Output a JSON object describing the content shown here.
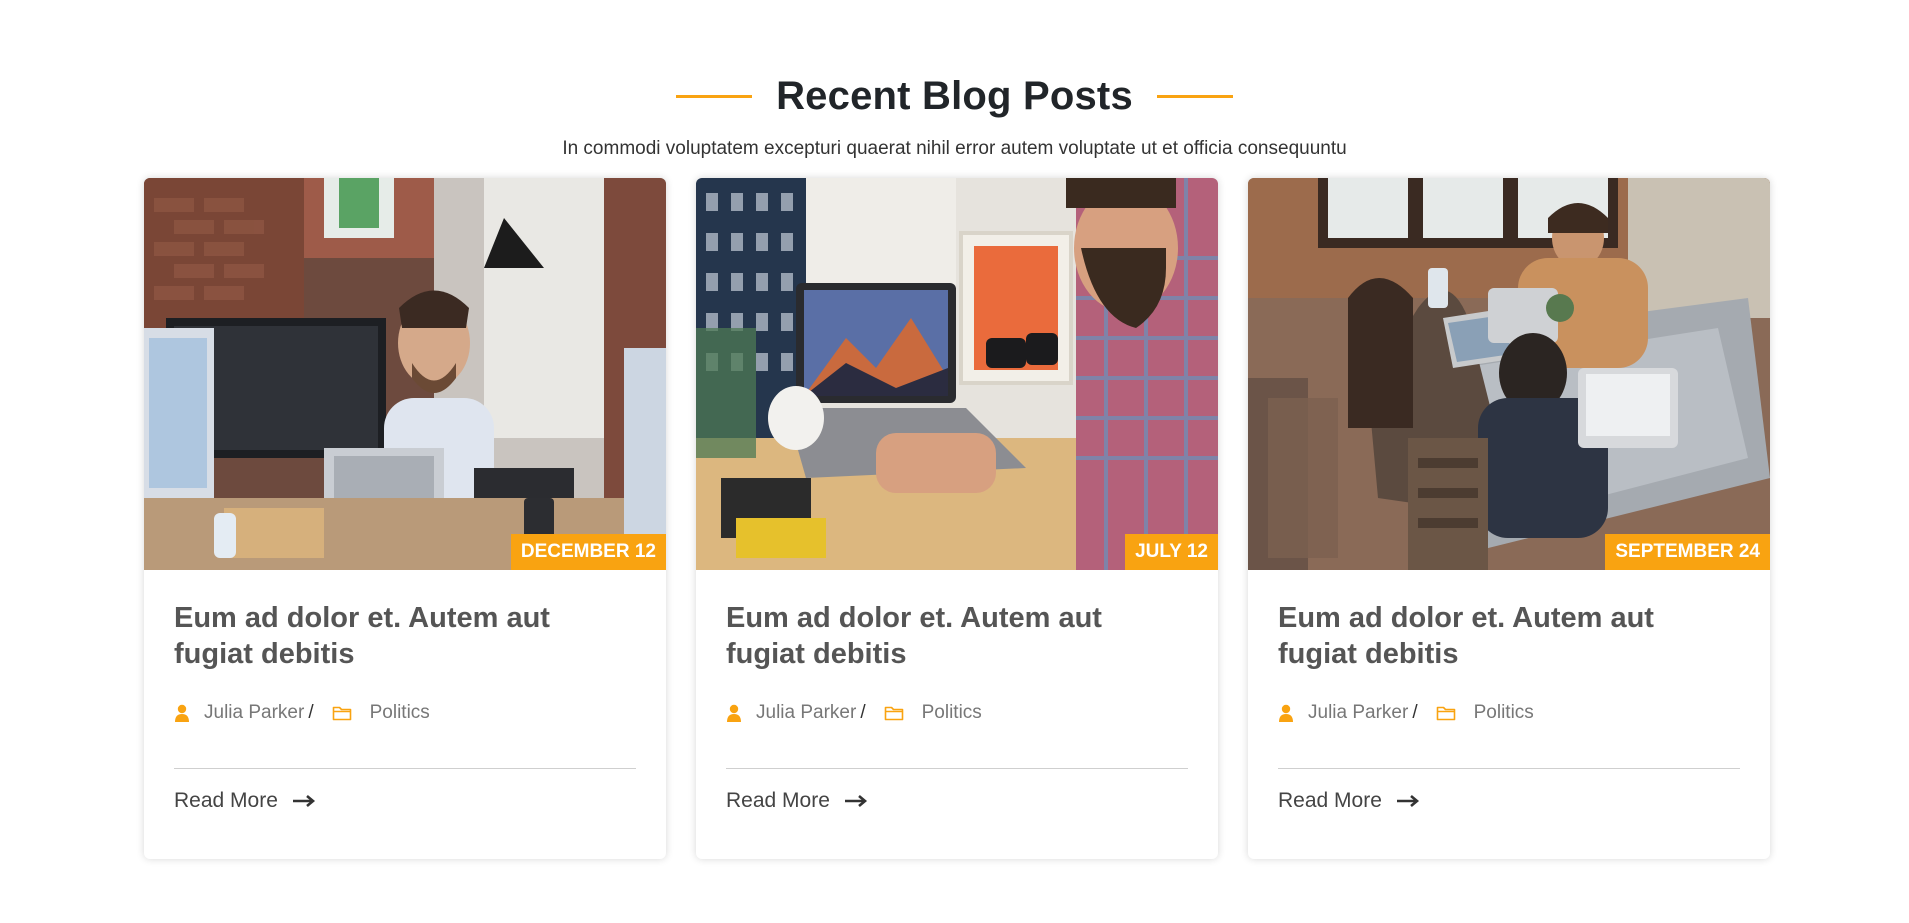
{
  "section": {
    "title": "Recent Blog Posts",
    "subtitle": "In commodi voluptatem excepturi quaerat nihil error autem voluptate ut et officia consequuntu",
    "accent_color": "#f9a311"
  },
  "posts": [
    {
      "date": "DECEMBER 12",
      "title": "Eum ad dolor et. Autem aut fugiat debitis",
      "author": "Julia Parker",
      "separator": "/",
      "category": "Politics",
      "read_more": "Read More",
      "image_description": "man-with-headset-at-computer-office"
    },
    {
      "date": "JULY 12",
      "title": "Eum ad dolor et. Autem aut fugiat debitis",
      "author": "Julia Parker",
      "separator": "/",
      "category": "Politics",
      "read_more": "Read More",
      "image_description": "man-typing-on-laptop-desk"
    },
    {
      "date": "SEPTEMBER 24",
      "title": "Eum ad dolor et. Autem aut fugiat debitis",
      "author": "Julia Parker",
      "separator": "/",
      "category": "Politics",
      "read_more": "Read More",
      "image_description": "team-working-laptops-table"
    }
  ],
  "icons": {
    "author": "user-icon",
    "category": "folder-icon",
    "read_more": "arrow-right-icon"
  }
}
